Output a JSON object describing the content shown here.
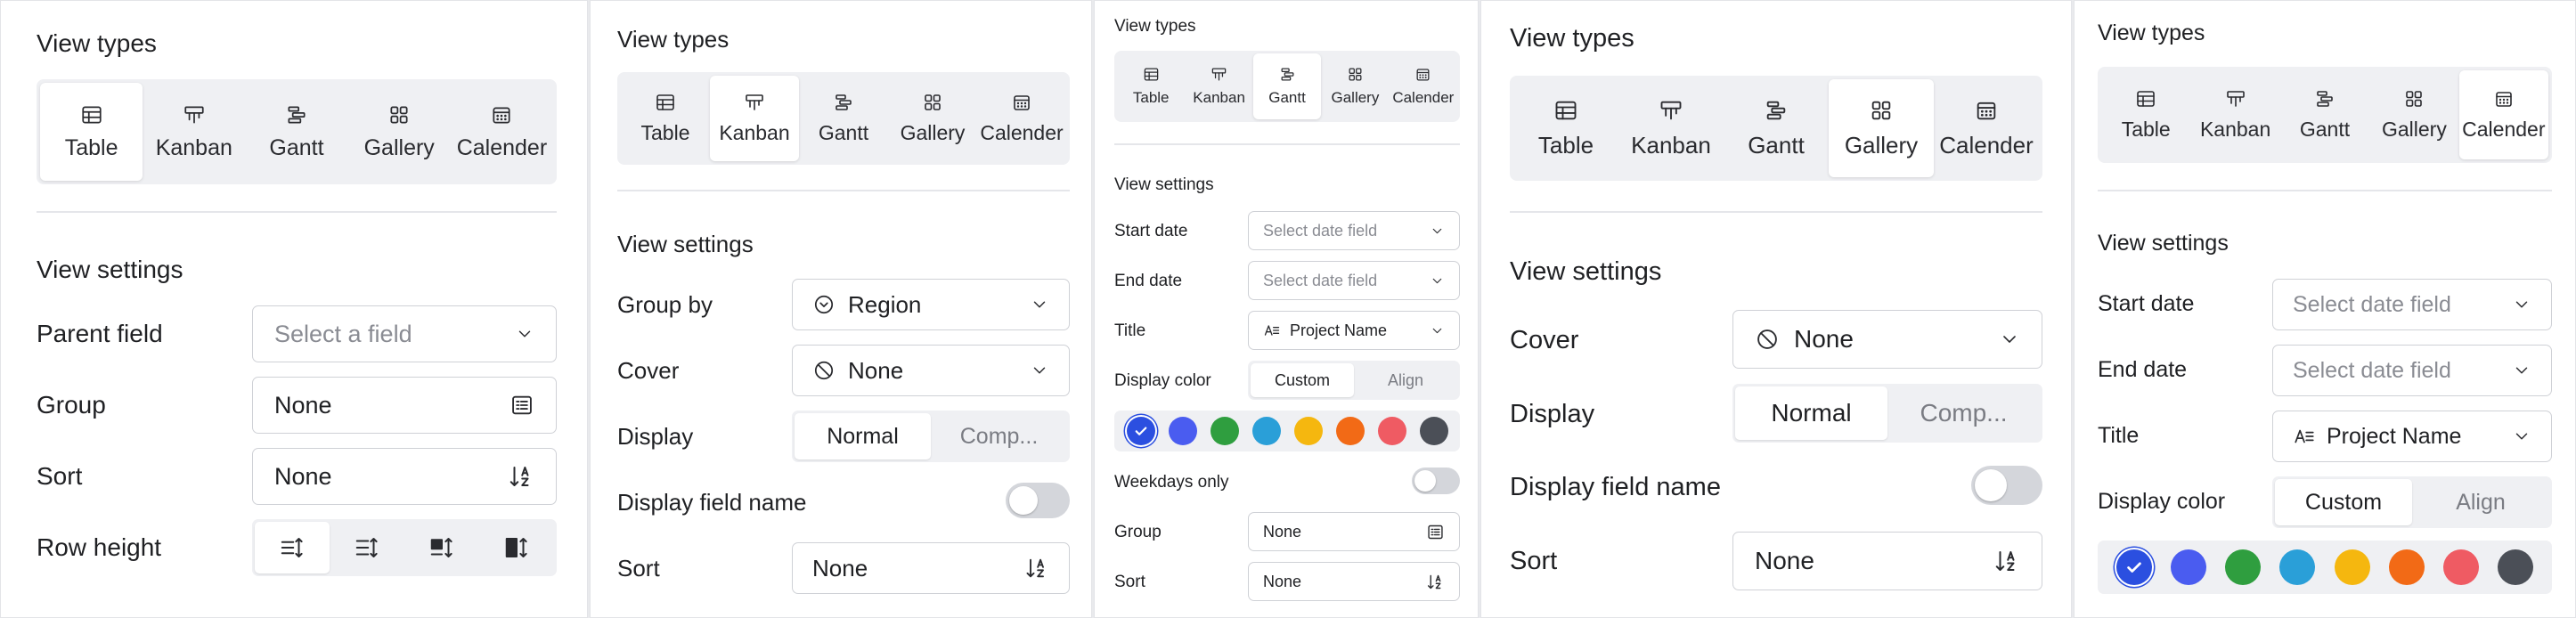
{
  "common": {
    "view_types_title": "View types",
    "view_settings_title": "View settings",
    "tabs": [
      "Table",
      "Kanban",
      "Gantt",
      "Gallery",
      "Calender"
    ]
  },
  "panel_table": {
    "parent_field_label": "Parent field",
    "parent_field_placeholder": "Select a field",
    "group_label": "Group",
    "group_value": "None",
    "sort_label": "Sort",
    "sort_value": "None",
    "row_height_label": "Row height"
  },
  "panel_kanban": {
    "group_by_label": "Group by",
    "group_by_value": "Region",
    "cover_label": "Cover",
    "cover_value": "None",
    "display_label": "Display",
    "display_options": [
      "Normal",
      "Comp..."
    ],
    "display_field_name_label": "Display field name",
    "sort_label": "Sort",
    "sort_value": "None"
  },
  "panel_gantt": {
    "start_date_label": "Start date",
    "start_date_placeholder": "Select date field",
    "end_date_label": "End date",
    "end_date_placeholder": "Select date field",
    "title_label": "Title",
    "title_value": "Project Name",
    "display_color_label": "Display color",
    "display_color_options": [
      "Custom",
      "Align"
    ],
    "weekdays_only_label": "Weekdays only",
    "group_label": "Group",
    "group_value": "None",
    "sort_label": "Sort",
    "sort_value": "None"
  },
  "panel_gallery": {
    "cover_label": "Cover",
    "cover_value": "None",
    "display_label": "Display",
    "display_options": [
      "Normal",
      "Comp..."
    ],
    "display_field_name_label": "Display field name",
    "sort_label": "Sort",
    "sort_value": "None"
  },
  "panel_calendar": {
    "start_date_label": "Start date",
    "start_date_placeholder": "Select date field",
    "end_date_label": "End date",
    "end_date_placeholder": "Select date field",
    "title_label": "Title",
    "title_value": "Project Name",
    "display_color_label": "Display color",
    "display_color_options": [
      "Custom",
      "Align"
    ]
  },
  "palette": [
    "#2b4fe0",
    "#4a5cf0",
    "#2f9e3f",
    "#2a9fd8",
    "#f5b70f",
    "#f26a16",
    "#ef5b63",
    "#4b4f57"
  ],
  "colors": {
    "border": "#cfd1d6",
    "segment_bg": "#eff0f3",
    "selected_check": "#ffffff"
  }
}
